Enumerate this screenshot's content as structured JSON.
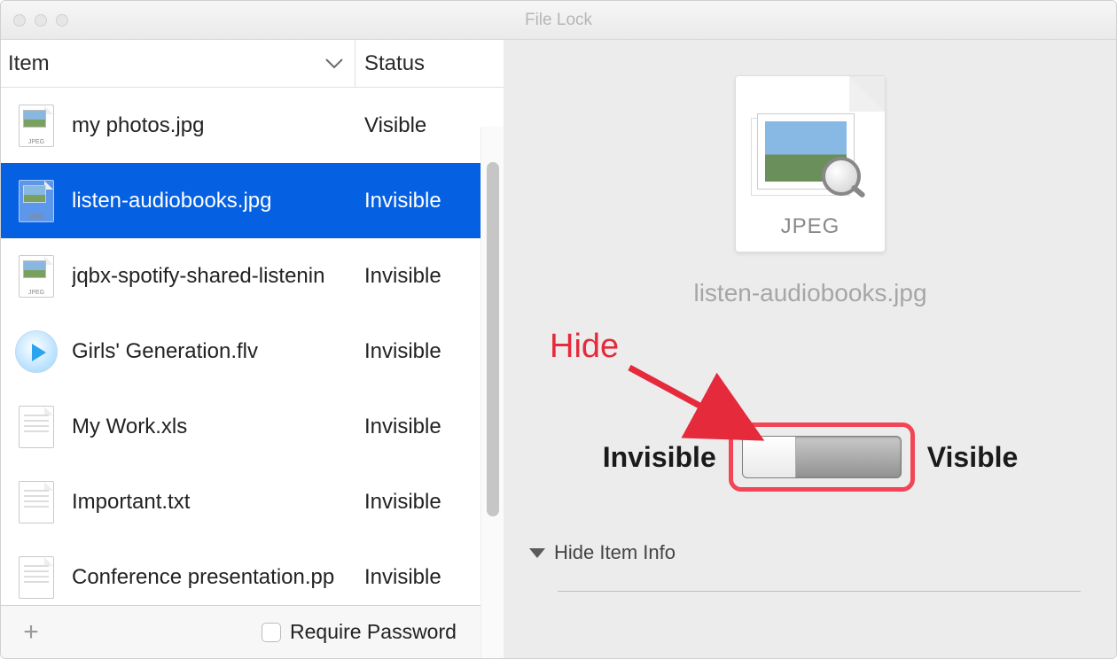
{
  "window": {
    "title": "File Lock"
  },
  "columns": {
    "item": "Item",
    "status": "Status"
  },
  "items": [
    {
      "name": "my photos.jpg",
      "status": "Visible",
      "type": "jpeg",
      "selected": false
    },
    {
      "name": "listen-audiobooks.jpg",
      "status": "Invisible",
      "type": "jpeg",
      "selected": true
    },
    {
      "name": "jqbx-spotify-shared-listenin",
      "status": "Invisible",
      "type": "jpeg",
      "selected": false
    },
    {
      "name": "Girls' Generation.flv",
      "status": "Invisible",
      "type": "flv",
      "selected": false
    },
    {
      "name": "My Work.xls",
      "status": "Invisible",
      "type": "xls",
      "selected": false
    },
    {
      "name": "Important.txt",
      "status": "Invisible",
      "type": "txt",
      "selected": false
    },
    {
      "name": "Conference presentation.pp",
      "status": "Invisible",
      "type": "ppt",
      "selected": false
    }
  ],
  "footer": {
    "require_password": "Require Password"
  },
  "detail": {
    "icon_label": "JPEG",
    "filename": "listen-audiobooks.jpg",
    "invisible_label": "Invisible",
    "visible_label": "Visible",
    "hide_item_info": "Hide Item Info"
  },
  "annotation": {
    "hide": "Hide"
  },
  "colors": {
    "selection": "#0560e2",
    "annotation": "#e52a3b"
  }
}
